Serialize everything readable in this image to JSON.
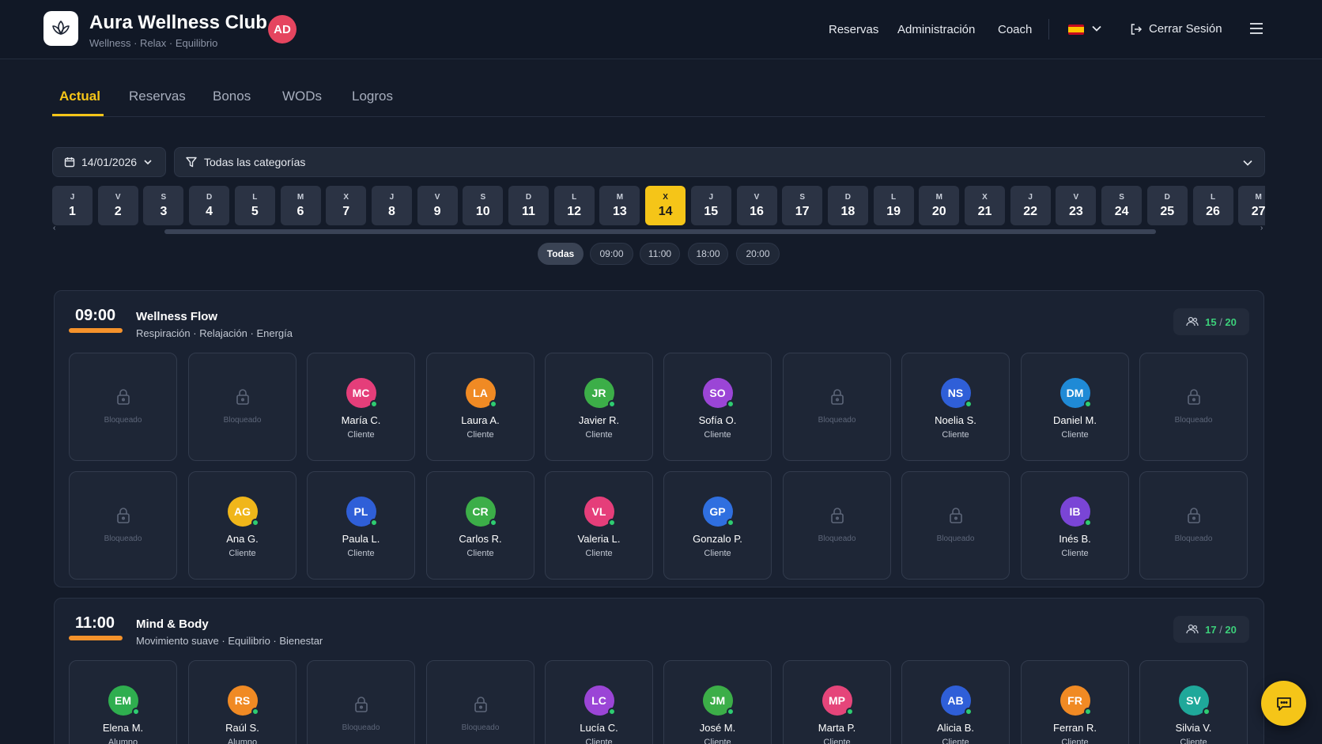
{
  "app": {
    "title": "Aura Wellness Club",
    "subtitle": "Wellness · Relax · Equilibrio",
    "user_initials": "AD"
  },
  "nav": {
    "reservas": "Reservas",
    "administracion": "Administración",
    "coach": "Coach",
    "logout": "Cerrar Sesión"
  },
  "tabs": [
    "Actual",
    "Reservas",
    "Bonos",
    "WODs",
    "Logros"
  ],
  "filters": {
    "date": "14/01/2026",
    "category": "Todas las categorías"
  },
  "days": [
    {
      "l": "J",
      "n": "1"
    },
    {
      "l": "V",
      "n": "2"
    },
    {
      "l": "S",
      "n": "3"
    },
    {
      "l": "D",
      "n": "4"
    },
    {
      "l": "L",
      "n": "5"
    },
    {
      "l": "M",
      "n": "6"
    },
    {
      "l": "X",
      "n": "7"
    },
    {
      "l": "J",
      "n": "8"
    },
    {
      "l": "V",
      "n": "9"
    },
    {
      "l": "S",
      "n": "10"
    },
    {
      "l": "D",
      "n": "11"
    },
    {
      "l": "L",
      "n": "12"
    },
    {
      "l": "M",
      "n": "13"
    },
    {
      "l": "X",
      "n": "14"
    },
    {
      "l": "J",
      "n": "15"
    },
    {
      "l": "V",
      "n": "16"
    },
    {
      "l": "S",
      "n": "17"
    },
    {
      "l": "D",
      "n": "18"
    },
    {
      "l": "L",
      "n": "19"
    },
    {
      "l": "M",
      "n": "20"
    },
    {
      "l": "X",
      "n": "21"
    },
    {
      "l": "J",
      "n": "22"
    },
    {
      "l": "V",
      "n": "23"
    },
    {
      "l": "S",
      "n": "24"
    },
    {
      "l": "D",
      "n": "25"
    },
    {
      "l": "L",
      "n": "26"
    },
    {
      "l": "M",
      "n": "27"
    }
  ],
  "active_day": "14",
  "time_filters": [
    "Todas",
    "09:00",
    "11:00",
    "18:00",
    "20:00"
  ],
  "locked_label": "Bloqueado",
  "sessions": [
    {
      "time": "09:00",
      "title": "Wellness Flow",
      "tags": "Respiración · Relajación · Energía",
      "booked": "15",
      "capacity": "20",
      "slots": [
        {
          "locked": true
        },
        {
          "locked": true
        },
        {
          "initials": "MC",
          "name": "María C.",
          "role": "Cliente",
          "color": "#e53e7a"
        },
        {
          "initials": "LA",
          "name": "Laura A.",
          "role": "Cliente",
          "color": "#f08a24"
        },
        {
          "initials": "JR",
          "name": "Javier R.",
          "role": "Cliente",
          "color": "#3cae48"
        },
        {
          "initials": "SO",
          "name": "Sofía O.",
          "role": "Cliente",
          "color": "#9b45d6"
        },
        {
          "locked": true
        },
        {
          "initials": "NS",
          "name": "Noelia S.",
          "role": "Cliente",
          "color": "#2f5fd8"
        },
        {
          "initials": "DM",
          "name": "Daniel M.",
          "role": "Cliente",
          "color": "#1f8ad6"
        },
        {
          "locked": true
        },
        {
          "locked": true
        },
        {
          "initials": "AG",
          "name": "Ana G.",
          "role": "Cliente",
          "color": "#f0b61a"
        },
        {
          "initials": "PL",
          "name": "Paula L.",
          "role": "Cliente",
          "color": "#2f5fd8"
        },
        {
          "initials": "CR",
          "name": "Carlos R.",
          "role": "Cliente",
          "color": "#3cae48"
        },
        {
          "initials": "VL",
          "name": "Valeria L.",
          "role": "Cliente",
          "color": "#e53e7a"
        },
        {
          "initials": "GP",
          "name": "Gonzalo P.",
          "role": "Cliente",
          "color": "#2f6fe0"
        },
        {
          "locked": true
        },
        {
          "locked": true
        },
        {
          "initials": "IB",
          "name": "Inés B.",
          "role": "Cliente",
          "color": "#7a45d6"
        },
        {
          "locked": true
        }
      ]
    },
    {
      "time": "11:00",
      "title": "Mind & Body",
      "tags": "Movimiento suave · Equilibrio · Bienestar",
      "booked": "17",
      "capacity": "20",
      "slots": [
        {
          "initials": "EM",
          "name": "Elena M.",
          "role": "Alumno",
          "color": "#2fae4f"
        },
        {
          "initials": "RS",
          "name": "Raúl S.",
          "role": "Alumno",
          "color": "#f08a24"
        },
        {
          "locked": true
        },
        {
          "locked": true
        },
        {
          "initials": "LC",
          "name": "Lucía C.",
          "role": "Cliente",
          "color": "#9b45d6"
        },
        {
          "initials": "JM",
          "name": "José M.",
          "role": "Cliente",
          "color": "#3cae48"
        },
        {
          "initials": "MP",
          "name": "Marta P.",
          "role": "Cliente",
          "color": "#e5457a"
        },
        {
          "initials": "AB",
          "name": "Alicia B.",
          "role": "Cliente",
          "color": "#2f5fd8"
        },
        {
          "initials": "FR",
          "name": "Ferran R.",
          "role": "Cliente",
          "color": "#f08a24"
        },
        {
          "initials": "SV",
          "name": "Silvia V.",
          "role": "Cliente",
          "color": "#1fa89a"
        }
      ]
    }
  ]
}
